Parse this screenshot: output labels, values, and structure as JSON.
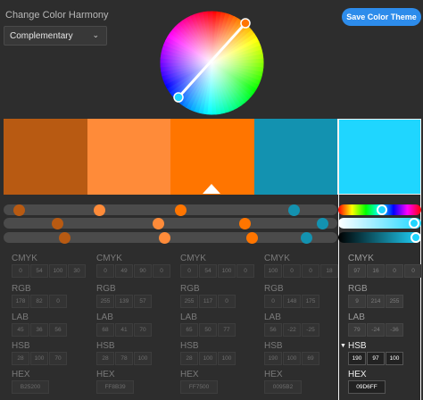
{
  "harmony": {
    "label": "Change Color Harmony",
    "selected": "Complementary"
  },
  "save_label": "Save Color Theme",
  "swatches": [
    {
      "hex": "#B85A12"
    },
    {
      "hex": "#FF8B39"
    },
    {
      "hex": "#FF7500"
    },
    {
      "hex": "#1392B0"
    },
    {
      "hex": "#1FD6FF"
    }
  ],
  "active_index": 4,
  "labels": {
    "cmyk": "CMYK",
    "rgb": "RGB",
    "lab": "LAB",
    "hsb": "HSB",
    "hex": "HEX"
  },
  "columns": [
    {
      "cmyk": [
        "0",
        "54",
        "100",
        "30"
      ],
      "rgb": [
        "178",
        "82",
        "0"
      ],
      "lab": [
        "45",
        "36",
        "56"
      ],
      "hsb": [
        "28",
        "100",
        "70"
      ],
      "hex": "B25200"
    },
    {
      "cmyk": [
        "0",
        "49",
        "90",
        "0"
      ],
      "rgb": [
        "255",
        "139",
        "57"
      ],
      "lab": [
        "68",
        "41",
        "70"
      ],
      "hsb": [
        "28",
        "78",
        "100"
      ],
      "hex": "FF8B39"
    },
    {
      "cmyk": [
        "0",
        "54",
        "100",
        "0"
      ],
      "rgb": [
        "255",
        "117",
        "0"
      ],
      "lab": [
        "65",
        "50",
        "77"
      ],
      "hsb": [
        "28",
        "100",
        "100"
      ],
      "hex": "FF7500"
    },
    {
      "cmyk": [
        "100",
        "0",
        "0",
        "18"
      ],
      "rgb": [
        "0",
        "148",
        "175"
      ],
      "lab": [
        "56",
        "-22",
        "-25"
      ],
      "hsb": [
        "190",
        "100",
        "69"
      ],
      "hex": "0095B2"
    },
    {
      "cmyk": [
        "97",
        "16",
        "0",
        "0"
      ],
      "rgb": [
        "9",
        "214",
        "255"
      ],
      "lab": [
        "79",
        "-24",
        "-36"
      ],
      "hsb": [
        "190",
        "97",
        "100"
      ],
      "hex": "09D6FF"
    }
  ],
  "sliders": {
    "hue": [
      0.03,
      0.28,
      0.53,
      0.88
    ],
    "saturation": [
      0.15,
      0.46,
      0.73,
      0.97
    ],
    "brightness": [
      0.17,
      0.48,
      0.75,
      0.92
    ],
    "active": {
      "hue": 0.53,
      "saturation": 0.97,
      "brightness": 1.0
    }
  }
}
